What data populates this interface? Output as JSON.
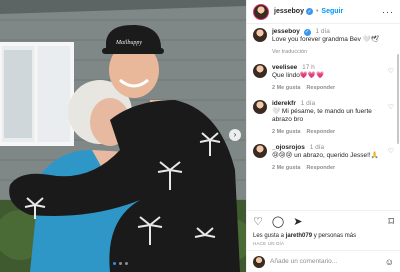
{
  "post": {
    "username": "jesseboy",
    "follow_label": "Seguir",
    "separator": "•",
    "more": "···"
  },
  "caption": {
    "username": "jesseboy",
    "time": "1 día",
    "text": "Love you forever grandma Bev 🤍🕊",
    "translate": "Ver traducción"
  },
  "comments": [
    {
      "username": "veelisee",
      "time": "17 h",
      "text": "Que lindo💗💗💗",
      "likes": "2 Me gusta",
      "reply": "Responder"
    },
    {
      "username": "iderekfr",
      "time": "1 día",
      "text": "🤍 Mi pésame, te mando un fuerte abrazo bro",
      "likes": "2 Me gusta",
      "reply": "Responder"
    },
    {
      "username": "_ojosrojos",
      "time": "1 día",
      "text": "😢😢😢 un abrazo, querido Jesse!!🙏",
      "likes": "2 Me gusta",
      "reply": "Responder"
    }
  ],
  "actions": {
    "like": "♡",
    "comment": "◯",
    "share": "➤",
    "save": "⌑"
  },
  "likes_line": {
    "prefix": "Les gusta a ",
    "user": "jareth079",
    "suffix": " y personas más"
  },
  "date": "HACE UN DÍA",
  "add_comment": {
    "placeholder": "Añade un comentario...",
    "emoji": "☺"
  },
  "photo": {
    "cap_text": "Mailbuppy",
    "next": "›"
  },
  "colors": {
    "accent": "#0095f6",
    "verified": "#3897f0",
    "grandma_shirt": "#2f97c8",
    "sweater": "#1a1a1a"
  }
}
